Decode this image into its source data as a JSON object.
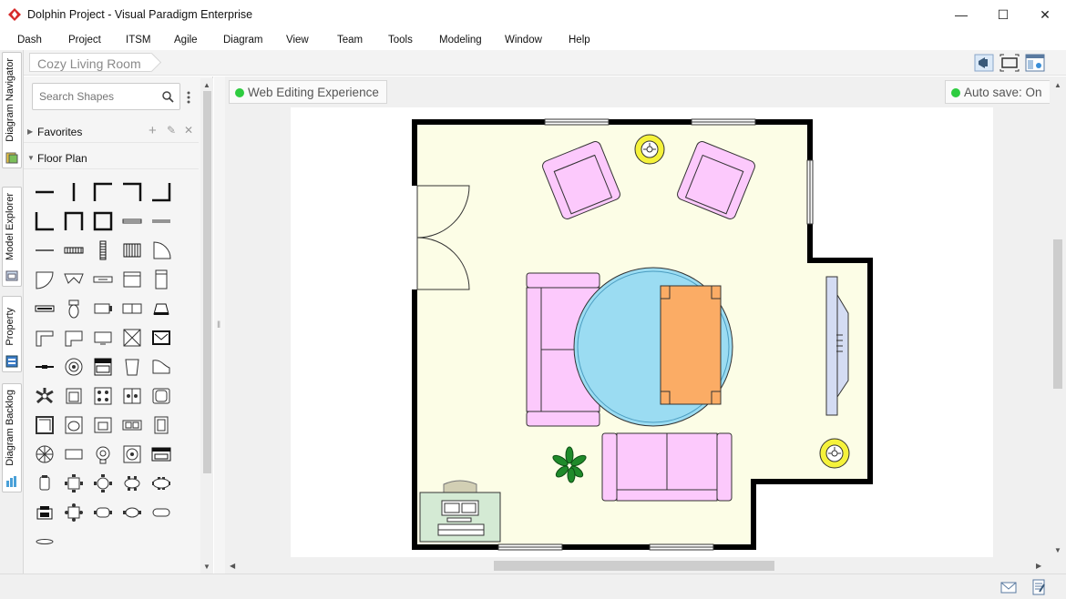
{
  "window": {
    "title": "Dolphin Project - Visual Paradigm Enterprise",
    "minimize": "—",
    "maximize": "☐",
    "close": "✕"
  },
  "menu": [
    "Dash",
    "Project",
    "ITSM",
    "Agile",
    "Diagram",
    "View",
    "Team",
    "Tools",
    "Modeling",
    "Window",
    "Help"
  ],
  "side_tabs": [
    "Diagram Navigator",
    "Model Explorer",
    "Property",
    "Diagram Backlog"
  ],
  "breadcrumb": "Cozy Living Room",
  "shapes_panel": {
    "search_placeholder": "Search Shapes",
    "favorites_label": "Favorites",
    "floor_plan_label": "Floor Plan"
  },
  "status_pills": {
    "web_editing": "Web Editing Experience",
    "auto_save": "Auto save: On"
  },
  "colors": {
    "accent_green": "#2ecc40",
    "floor": "#fcfde6",
    "sofa": "#fcc9fc",
    "rug": "#9bdcf2",
    "table": "#fbac65",
    "lamp": "#f5f23b",
    "tv": "#d4dcf3",
    "desk": "#d4ead4"
  }
}
